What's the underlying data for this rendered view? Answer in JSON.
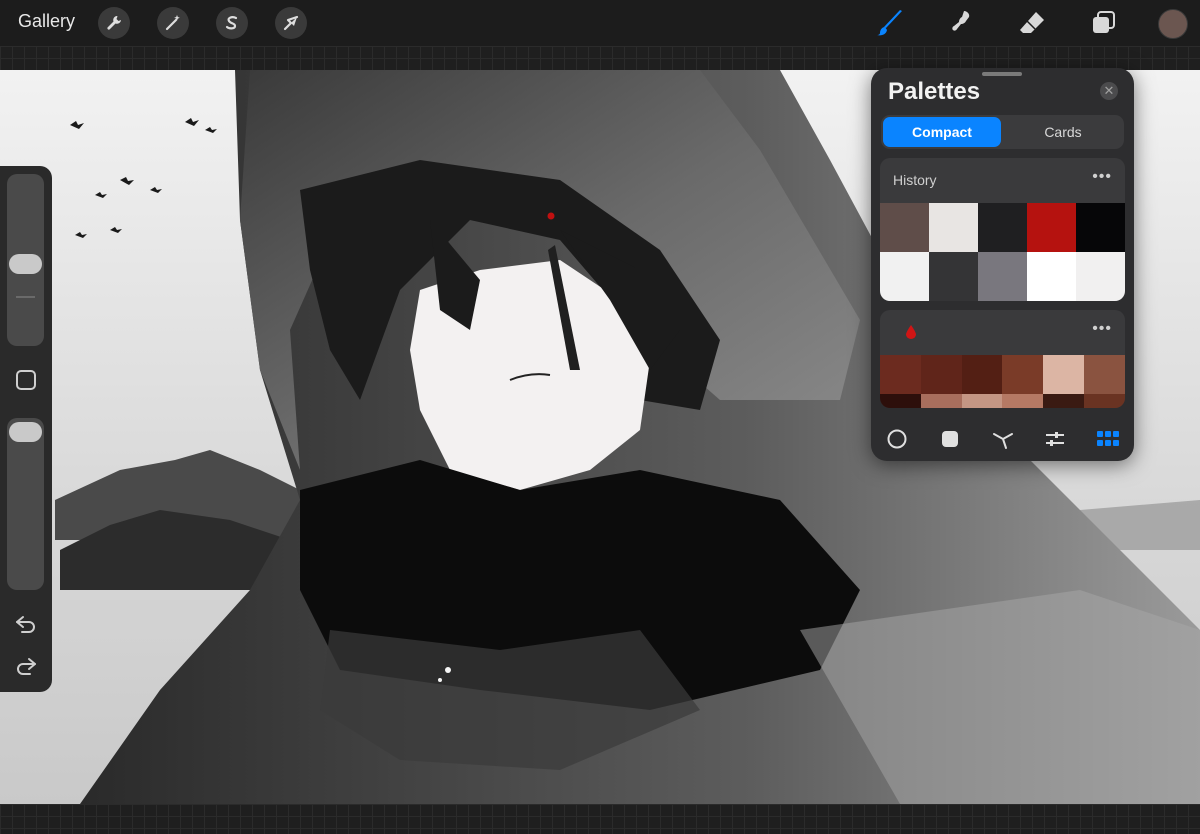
{
  "topbar": {
    "gallery_label": "Gallery",
    "left_tools": [
      "wrench-icon",
      "magic-wand-icon",
      "selection-icon",
      "transform-arrow-icon"
    ],
    "right_tools": [
      "brush-icon",
      "smudge-icon",
      "eraser-icon",
      "layers-icon"
    ],
    "active_tool": "brush-icon",
    "current_color": "#6b5650"
  },
  "sidebar": {
    "brush_size_level": 0.47,
    "opacity_level": 0.0,
    "tools": [
      "modify-square-icon",
      "undo-icon",
      "redo-icon"
    ]
  },
  "palettes_panel": {
    "title": "Palettes",
    "tabs": [
      {
        "label": "Compact",
        "active": true
      },
      {
        "label": "Cards",
        "active": false
      }
    ],
    "history": {
      "name": "History",
      "more_label": "•••",
      "colors": [
        "#5f4d49",
        "#e8e5e3",
        "#1f1f21",
        "#b5120f",
        "#060608",
        "#f1f1f1",
        "#343436",
        "#79777e",
        "#ffffff",
        "#f1f0f0"
      ]
    },
    "custom": {
      "name_icon": "blood-drop-icon",
      "more_label": "•••",
      "colors": [
        "#6c2b1f",
        "#60251a",
        "#531f14",
        "#7a3b28",
        "#dcb5a4",
        "#8a5340",
        "#2d0f0b",
        "#a86e5d",
        "#c49684",
        "#b57964",
        "#3a1a12",
        "#6a3322"
      ]
    },
    "footer_icons": [
      "disc-icon",
      "classic-icon",
      "harmony-icon",
      "values-icon",
      "palettes-icon"
    ],
    "active_footer": "palettes-icon",
    "accent": "#0a84ff"
  }
}
